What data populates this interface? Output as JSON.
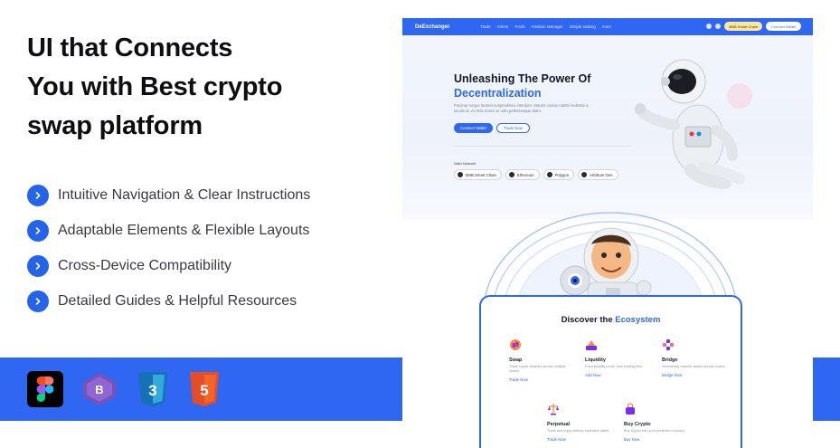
{
  "headline": {
    "line1": "UI that Connects",
    "line2": "You with Best crypto",
    "line3": "swap platform"
  },
  "features": [
    {
      "label": "Intuitive Navigation & Clear Instructions"
    },
    {
      "label": "Adaptable Elements & Flexible Layouts"
    },
    {
      "label": "Cross-Device Compatibility"
    },
    {
      "label": "Detailed Guides & Helpful Resources"
    }
  ],
  "tech_icons": [
    "figma-icon",
    "bootstrap-icon",
    "css3-icon",
    "html5-icon"
  ],
  "colors": {
    "accent": "#2f66f2",
    "hero_title": "#121829",
    "chain_pill": "#ffe89a"
  },
  "mockup": {
    "nav": {
      "brand": "DeExchanger",
      "links": [
        "Trade",
        "Farms",
        "Pools",
        "Position Manager",
        "Simple staking",
        "more"
      ],
      "chain_button": "BNB Smart Chain",
      "wallet_button": "Connect Wallet"
    },
    "hero": {
      "title_line1": "Unleashing The Power Of",
      "title_line2": "Decentralization",
      "description": "Pulvinar neque laoreet suspendisse interdum. Mauris cursus mattis molestie a iaculis at. Ac felis donec et odio pellentesque diam.",
      "primary_button": "Connect Wallet",
      "secondary_button": "Trade Now",
      "network_label": "Valid Network",
      "networks": [
        "BNB Smart Chain",
        "Ethereum",
        "Polygon",
        "Arbitrum One"
      ]
    },
    "ecosystem": {
      "title_prefix": "Discover the",
      "title_accent": "Ecosystem",
      "items": [
        {
          "name": "Swap",
          "desc": "Trade crypto instantly across multiple chains",
          "link": "Trade Now"
        },
        {
          "name": "Liquidity",
          "desc": "Fund liquidity pools, earn trading fees",
          "link": "Add Now"
        },
        {
          "name": "Bridge",
          "desc": "Seamlessly transfer assets across chains",
          "link": "Bridge Now"
        },
        {
          "name": "Perpetual",
          "desc": "Trade and enjoy without expiration dates",
          "link": "Trade Now"
        },
        {
          "name": "Buy Crypto",
          "desc": "Buy Crypto with your preferred currency",
          "link": "Buy Now"
        }
      ]
    }
  }
}
